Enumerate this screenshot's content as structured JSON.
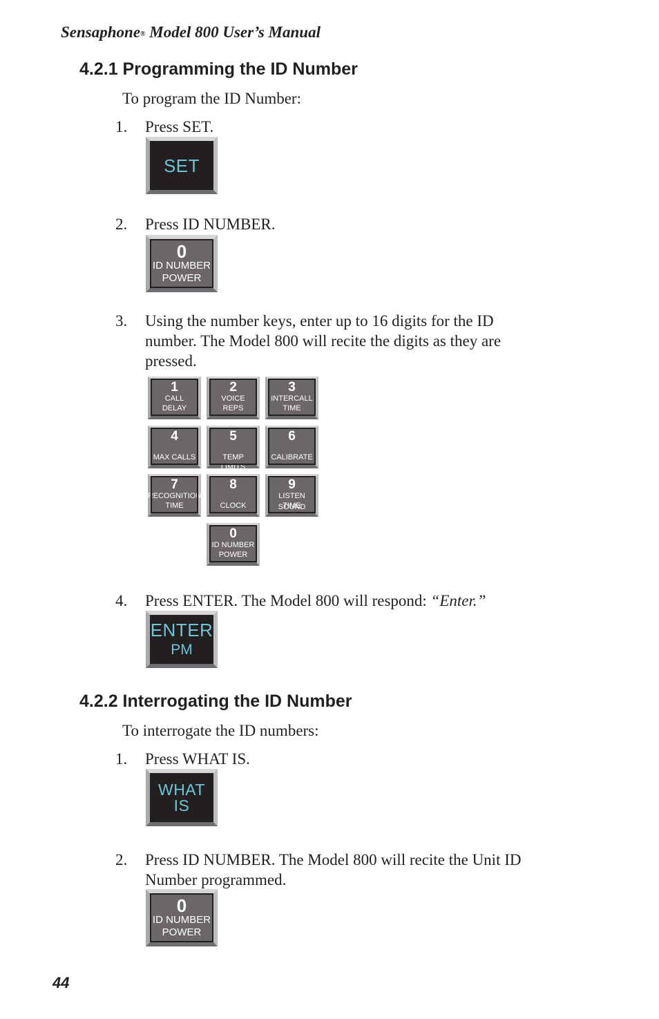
{
  "header": {
    "brand": "Sensaphone",
    "registered_mark": "®",
    "title_rest": " Model 800 User’s Manual"
  },
  "section1": {
    "heading": "4.2.1  Programming the ID Number",
    "intro": "To program the ID Number:",
    "steps": [
      {
        "number": "1.",
        "text": "Press SET."
      },
      {
        "number": "2.",
        "text": "Press ID NUMBER."
      },
      {
        "number": "3.",
        "text": "Using the number keys, enter up to 16 digits for the ID number. The Model 800 will recite the digits as they are pressed."
      },
      {
        "number": "4.",
        "text_before": "Press ENTER. The Model 800 will respond: ",
        "text_quote": "“Enter.”"
      }
    ]
  },
  "section2": {
    "heading": "4.2.2  Interrogating the ID Number",
    "intro": "To interrogate the ID numbers:",
    "steps": [
      {
        "number": "1.",
        "text": "Press WHAT IS."
      },
      {
        "number": "2.",
        "text": "Press ID NUMBER. The Model 800 will recite the Unit ID Number programmed."
      }
    ]
  },
  "keys": {
    "set": {
      "label": "SET"
    },
    "id_number": {
      "digit": "0",
      "line1": "ID NUMBER",
      "line2": "POWER"
    },
    "enter": {
      "line1": "ENTER",
      "line2": "PM"
    },
    "what_is": {
      "line1": "WHAT",
      "line2": "IS"
    },
    "keypad": [
      {
        "digit": "1",
        "line1": "CALL",
        "line2": "DELAY"
      },
      {
        "digit": "2",
        "line1": "VOICE",
        "line2": "REPS"
      },
      {
        "digit": "3",
        "line1": "INTERCALL",
        "line2": "TIME"
      },
      {
        "digit": "4",
        "line1": "",
        "line2": "MAX CALLS"
      },
      {
        "digit": "5",
        "line1": "",
        "line2": "TEMP LIMITS"
      },
      {
        "digit": "6",
        "line1": "",
        "line2": "CALIBRATE"
      },
      {
        "digit": "7",
        "line1": "RECOGNITION",
        "line2": "TIME"
      },
      {
        "digit": "8",
        "line1": "",
        "line2": "CLOCK"
      },
      {
        "digit": "9",
        "line1": "LISTEN TIME",
        "line2": "SOUND"
      },
      {
        "digit": "0",
        "line1": "ID NUMBER",
        "line2": "POWER"
      }
    ],
    "colors": {
      "dark_face": "#231f20",
      "cyan_text": "#6cc5d9",
      "grey_face": "#6b6768"
    }
  },
  "footer": {
    "page_number": "44"
  }
}
